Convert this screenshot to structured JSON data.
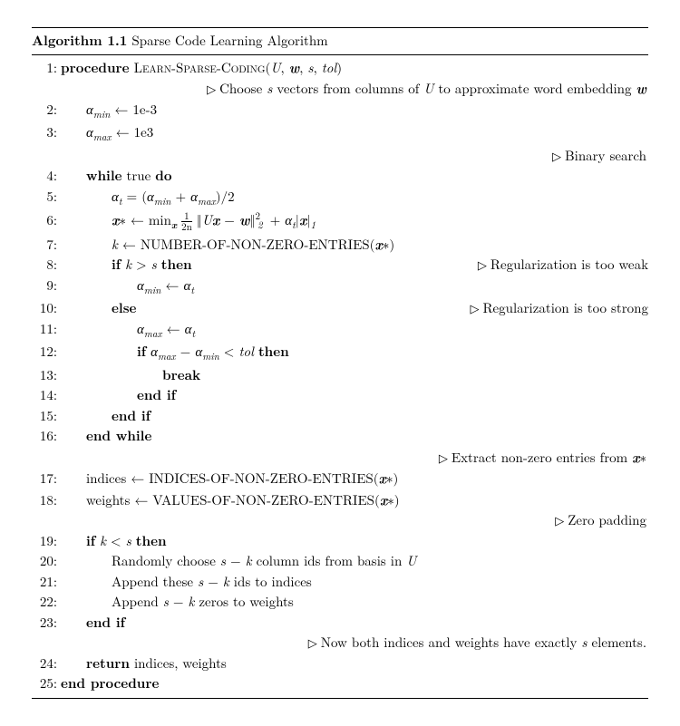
{
  "title_prefix": "Algorithm 1.1",
  "title_text": "Sparse Code Learning Algorithm",
  "lines": {
    "l1": "procedure",
    "l1b": "Learn-Sparse-Coding",
    "l1c": "(U, 𝒘, s, tol)",
    "c1": "Choose s vectors from columns of U to approximate word embedding 𝒘",
    "l2": "α_min ← 1e-3",
    "l3": "α_max ← 1e3",
    "c3": "Binary search",
    "l4": "while true do",
    "l5": "α_t = (α_min + α_max)/2",
    "l6": "𝒙∗ ← min_𝒙 1/(2n) ‖U𝒙 − 𝒘‖²₂ + α_t|𝒙|₁",
    "l7": "k ← NUMBER-OF-NON-ZERO-ENTRIES(𝒙∗)",
    "l8": "if k > s then",
    "c8": "Regularization is too weak",
    "l9": "α_min ← α_t",
    "l10": "else",
    "c10": "Regularization is too strong",
    "l11": "α_max ← α_t",
    "l12": "if α_max − α_min < tol then",
    "l13": "break",
    "l14": "end if",
    "l15": "end if",
    "l16": "end while",
    "c16": "Extract non-zero entries from 𝒙∗",
    "l17": "indices ← INDICES-OF-NON-ZERO-ENTRIES(𝒙∗)",
    "l18": "weights ← VALUES-OF-NON-ZERO-ENTRIES(𝒙∗)",
    "c18": "Zero padding",
    "l19": "if k < s then",
    "l20": "Randomly choose s − k column ids from basis in U",
    "l21": "Append these s − k ids to indices",
    "l22": "Append s − k zeros to weights",
    "l23": "end if",
    "c23": "Now both indices and weights have exactly s elements.",
    "l24": "return",
    "l24b": "indices, weights",
    "l25": "end procedure"
  }
}
